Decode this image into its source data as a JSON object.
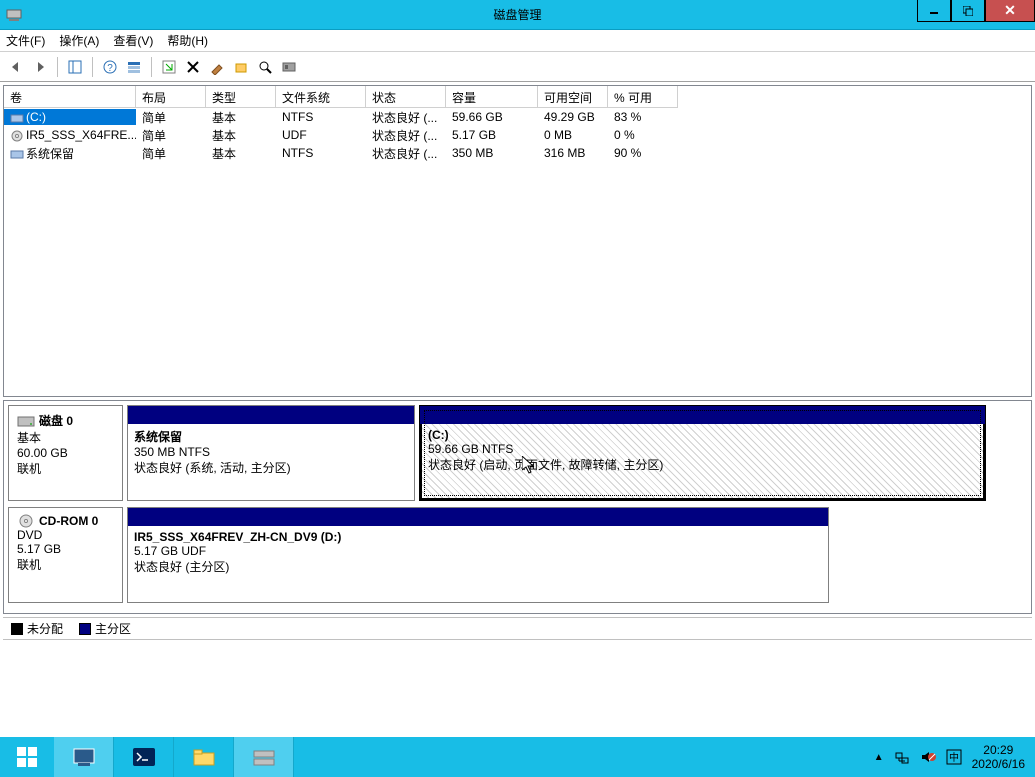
{
  "window": {
    "title": "磁盘管理",
    "buttons": {
      "min": "─",
      "max": "□",
      "close": "✕"
    }
  },
  "menu": {
    "file": "文件(F)",
    "action": "操作(A)",
    "view": "查看(V)",
    "help": "帮助(H)"
  },
  "columns": [
    "卷",
    "布局",
    "类型",
    "文件系统",
    "状态",
    "容量",
    "可用空间",
    "% 可用"
  ],
  "volumes": [
    {
      "name": "(C:)",
      "layout": "简单",
      "type": "基本",
      "fs": "NTFS",
      "status": "状态良好 (...",
      "capacity": "59.66 GB",
      "free": "49.29 GB",
      "pct": "83 %",
      "selected": true,
      "icon": "volume"
    },
    {
      "name": "IR5_SSS_X64FRE...",
      "layout": "简单",
      "type": "基本",
      "fs": "UDF",
      "status": "状态良好 (...",
      "capacity": "5.17 GB",
      "free": "0 MB",
      "pct": "0 %",
      "selected": false,
      "icon": "dvd"
    },
    {
      "name": "系统保留",
      "layout": "简单",
      "type": "基本",
      "fs": "NTFS",
      "status": "状态良好 (...",
      "capacity": "350 MB",
      "free": "316 MB",
      "pct": "90 %",
      "selected": false,
      "icon": "volume"
    }
  ],
  "disks": [
    {
      "id": "磁盘 0",
      "kind": "基本",
      "size": "60.00 GB",
      "state": "联机",
      "icon": "hdd",
      "partitions": [
        {
          "title": "系统保留",
          "sub": "350 MB NTFS",
          "status": "状态良好 (系统, 活动, 主分区)",
          "widthPct": 32,
          "selected": false
        },
        {
          "title": "(C:)",
          "sub": "59.66 GB NTFS",
          "status": "状态良好 (启动, 页面文件, 故障转储, 主分区)",
          "widthPct": 63,
          "selected": true
        }
      ]
    },
    {
      "id": "CD-ROM 0",
      "kind": "DVD",
      "size": "5.17 GB",
      "state": "联机",
      "icon": "dvd",
      "partitions": [
        {
          "title": "IR5_SSS_X64FREV_ZH-CN_DV9  (D:)",
          "sub": "5.17 GB UDF",
          "status": "状态良好 (主分区)",
          "widthPct": 78,
          "selected": false
        }
      ]
    }
  ],
  "legend": {
    "unalloc": "未分配",
    "primary": "主分区"
  },
  "taskbar": {
    "time": "20:29",
    "date": "2020/6/16"
  }
}
